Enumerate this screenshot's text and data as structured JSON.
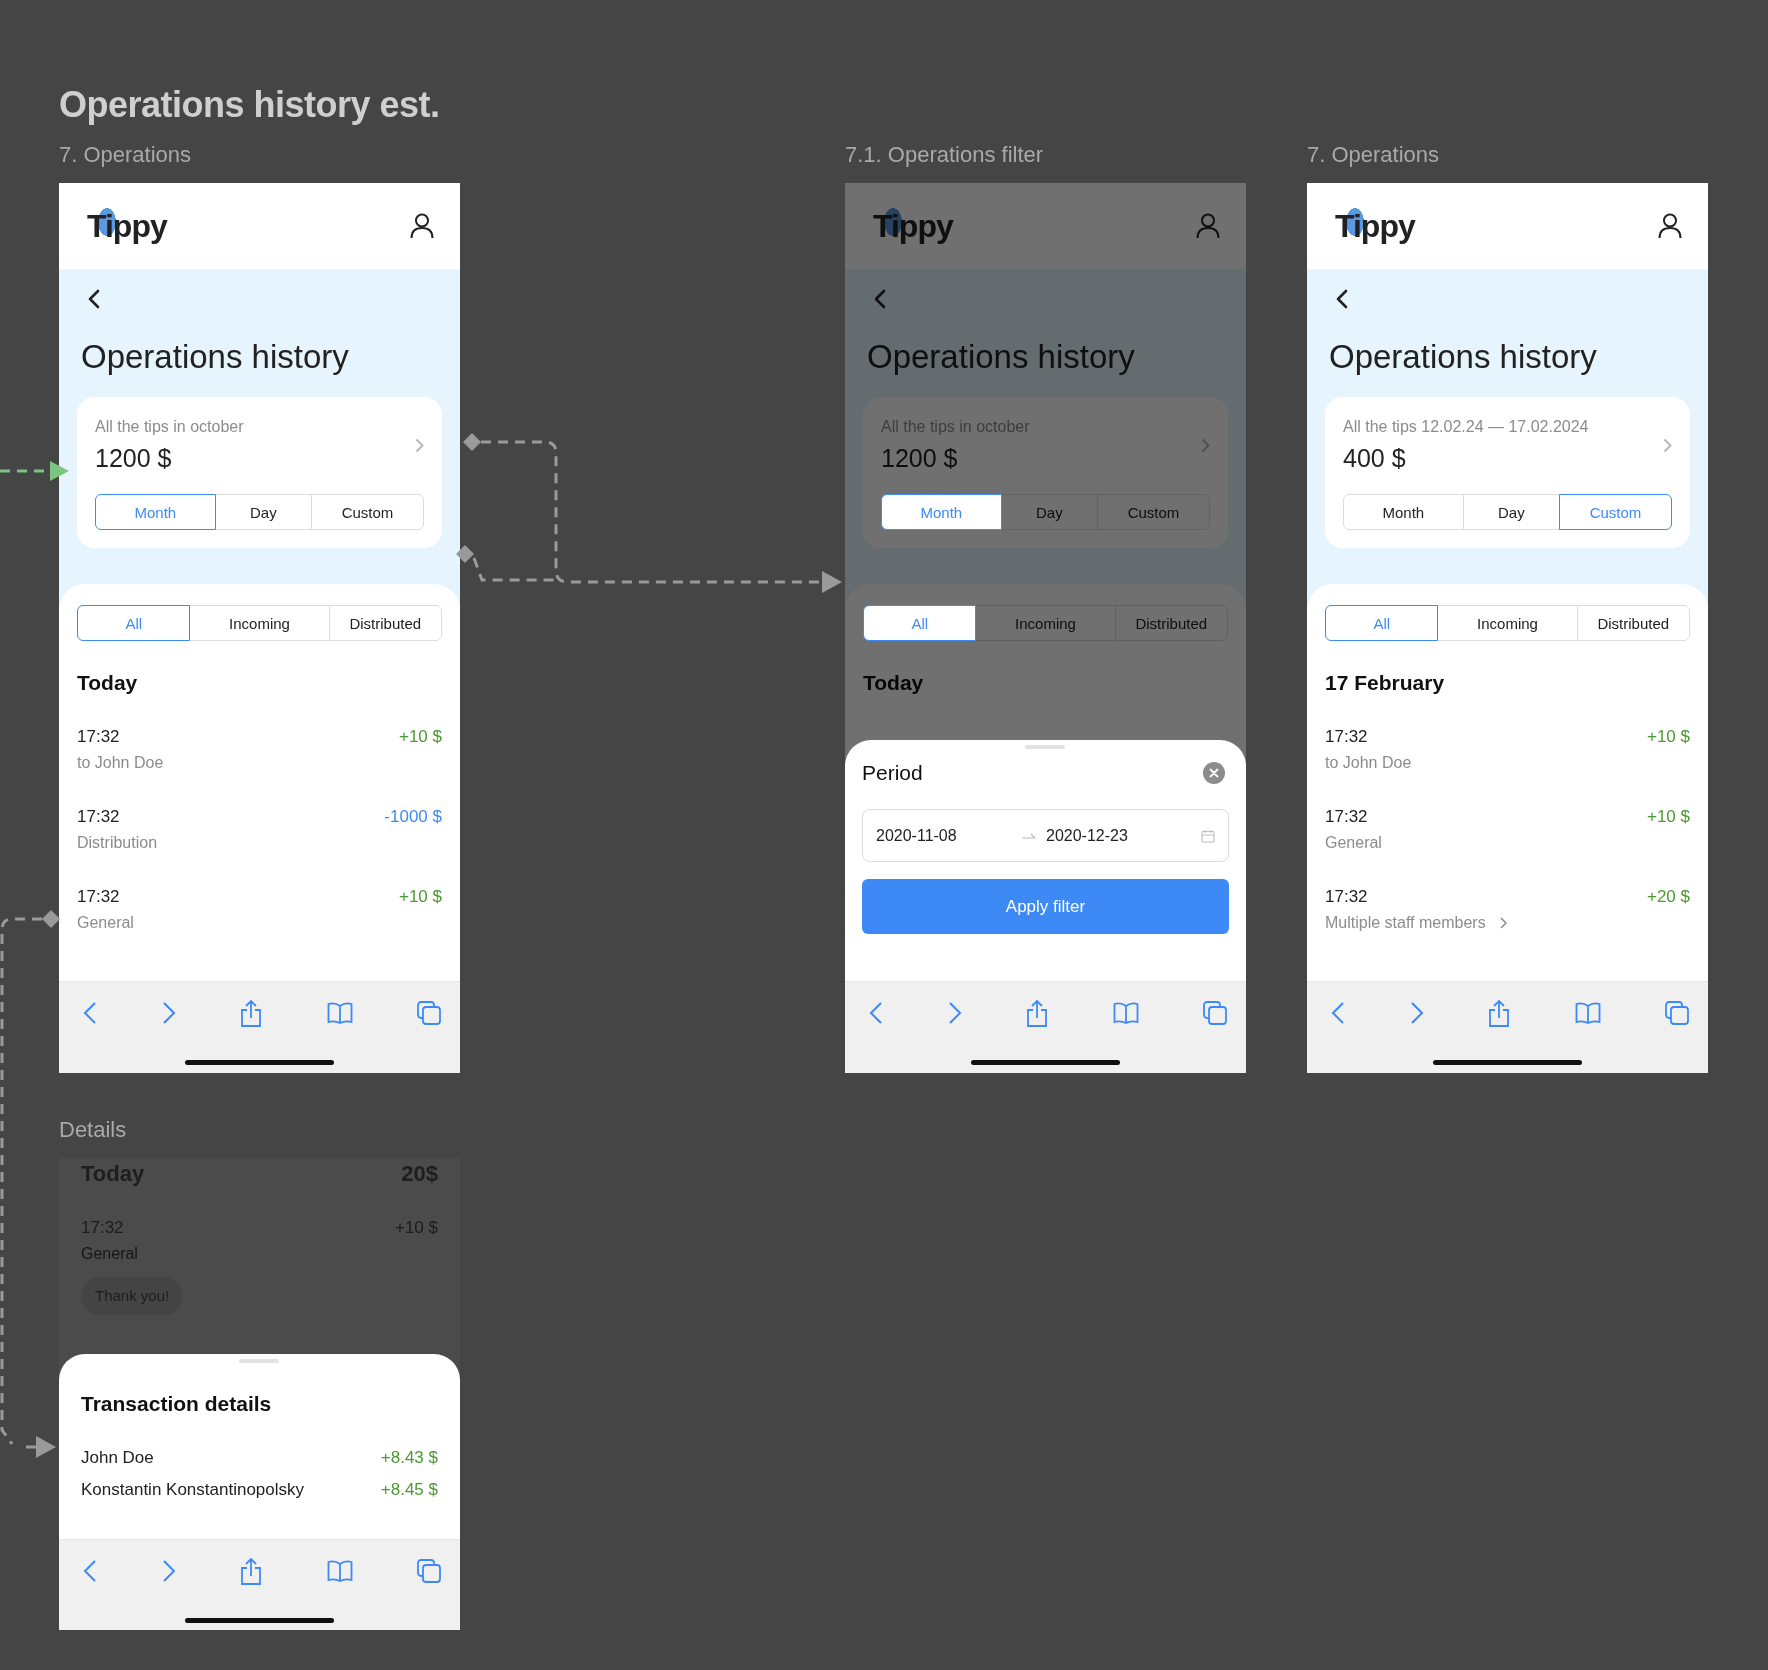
{
  "page_title": "Operations history est.",
  "screens": [
    {
      "label": "7. Operations",
      "logo": "Tippy",
      "title": "Operations history",
      "summary": {
        "caption": "All the tips in october",
        "amount": "1200 $"
      },
      "periods": [
        {
          "label": "Month",
          "selected": true
        },
        {
          "label": "Day",
          "selected": false
        },
        {
          "label": "Custom",
          "selected": false
        }
      ],
      "filters": [
        {
          "label": "All",
          "selected": true
        },
        {
          "label": "Incoming",
          "selected": false
        },
        {
          "label": "Distributed",
          "selected": false
        }
      ],
      "day": "Today",
      "rows": [
        {
          "time": "17:32",
          "note": "to John Doe",
          "amount": "+10 $",
          "kind": "in"
        },
        {
          "time": "17:32",
          "note": "Distribution",
          "amount": "-1000 $",
          "kind": "out"
        },
        {
          "time": "17:32",
          "note": "General",
          "amount": "+10 $",
          "kind": "in"
        }
      ]
    },
    {
      "label": "7.1. Operations filter",
      "logo": "Tippy",
      "title": "Operations history",
      "summary": {
        "caption": "All the tips in october",
        "amount": "1200 $"
      },
      "periods": [
        {
          "label": "Month",
          "selected": true
        },
        {
          "label": "Day",
          "selected": false
        },
        {
          "label": "Custom",
          "selected": false
        }
      ],
      "filters": [
        {
          "label": "All",
          "selected": true
        },
        {
          "label": "Incoming",
          "selected": false
        },
        {
          "label": "Distributed",
          "selected": false
        }
      ],
      "day": "Today",
      "sheet": {
        "title": "Period",
        "start": "2020-11-08",
        "end": "2020-12-23",
        "button": "Apply filter"
      }
    },
    {
      "label": "7. Operations",
      "logo": "Tippy",
      "title": "Operations history",
      "summary": {
        "caption": "All the tips 12.02.24 — 17.02.2024",
        "amount": "400 $"
      },
      "periods": [
        {
          "label": "Month",
          "selected": false
        },
        {
          "label": "Day",
          "selected": false
        },
        {
          "label": "Custom",
          "selected": true
        }
      ],
      "filters": [
        {
          "label": "All",
          "selected": true
        },
        {
          "label": "Incoming",
          "selected": false
        },
        {
          "label": "Distributed",
          "selected": false
        }
      ],
      "day": "17 February",
      "rows": [
        {
          "time": "17:32",
          "note": "to John Doe",
          "amount": "+10 $",
          "kind": "in"
        },
        {
          "time": "17:32",
          "note": "General",
          "amount": "+10 $",
          "kind": "in"
        },
        {
          "time": "17:32",
          "note": "Multiple staff members",
          "amount": "+20 $",
          "kind": "in",
          "has_chevron": true
        }
      ]
    }
  ],
  "details": {
    "label": "Details",
    "day": "Today",
    "total": "20$",
    "row": {
      "time": "17:32",
      "note": "General",
      "amount": "+10 $"
    },
    "message": "Thank you!",
    "sheet": {
      "title": "Transaction details",
      "items": [
        {
          "name": "John Doe",
          "amount": "+8.43 $"
        },
        {
          "name": "Konstantin Konstantinopolsky",
          "amount": "+8.45 $"
        }
      ]
    }
  }
}
